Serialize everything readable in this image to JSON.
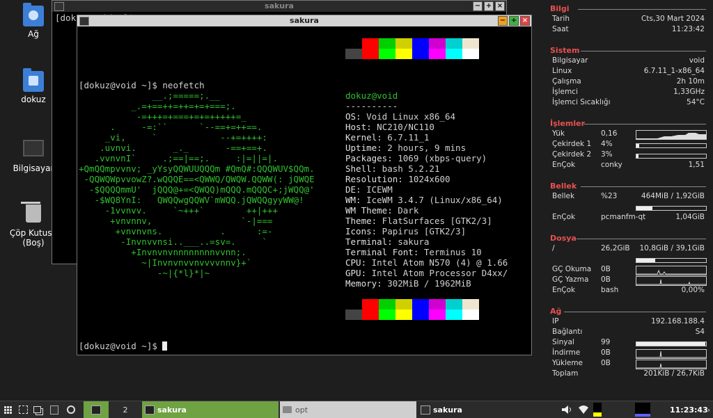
{
  "desktop": {
    "icons": [
      "Ağ",
      "dokuz",
      "Bilgisayar",
      "Çöp Kutusu (Boş)"
    ]
  },
  "windows": {
    "back_title": "sakura",
    "back_prompt": "[dokuz@void ~]$",
    "front_title": "sakura"
  },
  "terminal": {
    "prompt1": "[dokuz@void ~]$ neofetch",
    "prompt2": "[dokuz@void ~]$",
    "user_host": "dokuz@void",
    "separator": "----------",
    "info": [
      {
        "label": "OS",
        "value": "Void Linux x86_64"
      },
      {
        "label": "Host",
        "value": "NC210/NC110"
      },
      {
        "label": "Kernel",
        "value": "6.7.11_1"
      },
      {
        "label": "Uptime",
        "value": "2 hours, 9 mins"
      },
      {
        "label": "Packages",
        "value": "1069 (xbps-query)"
      },
      {
        "label": "Shell",
        "value": "bash 5.2.21"
      },
      {
        "label": "Resolution",
        "value": "1024x600"
      },
      {
        "label": "DE",
        "value": "ICEWM"
      },
      {
        "label": "WM",
        "value": "IceWM 3.4.7 (Linux/x86_64)"
      },
      {
        "label": "WM Theme",
        "value": "Dark"
      },
      {
        "label": "Theme",
        "value": "FlatSurfaces [GTK2/3]"
      },
      {
        "label": "Icons",
        "value": "Papirus [GTK2/3]"
      },
      {
        "label": "Terminal",
        "value": "sakura"
      },
      {
        "label": "Terminal Font",
        "value": "Terminus 10"
      },
      {
        "label": "CPU",
        "value": "Intel Atom N570 (4) @ 1.66"
      },
      {
        "label": "GPU",
        "value": "Intel Atom Processor D4xx/"
      },
      {
        "label": "Memory",
        "value": "302MiB / 1962MiB"
      }
    ],
    "ascii": [
      "              __.;=====;.__",
      "          _.=+==++=++=+=+===;.",
      "           -=+++=+===+=+=+++++=_",
      "      .     -=:``      `--==+=++==.",
      "     _vi,     `            --+=++++:",
      "    .uvnvi.       _._       -==+==+.",
      "   .vvnvnI`     .;==|==;.     :|=||=|.",
      "+QmQQmpvvnv; _yYsyQQWUUQQQm #QmQ#:QQQWUV$QQm.",
      " -QQWQWpvvowZ?.wQQQE==<QWWQ/QWQW.QQWW(: jQWQE",
      "  -$QQQQmmU'  jQQQ@+=<QWQQ)mQQQ.mQQQC+;jWQQ@'",
      "   -$WQ8YnI:   QWQQwgQQWV`mWQQ.jQWQQgyyWW@!",
      "     -1vvnvv.     `~+++`        ++|+++",
      "      +vnvnnv,                 `-|===",
      "       +vnvnvns.           .      :=-",
      "        -Invnvvnsi..___..=sv=.     `",
      "          +Invnvnvnnnnnnnnvvnn;.",
      "            ~|Invnvnvvnvvvvnnv}+`",
      "               -~|{*l}*|~"
    ],
    "palette_top": [
      "#000000",
      "#ff0000",
      "#00d000",
      "#d0d000",
      "#0000ff",
      "#d000d0",
      "#00d0d0",
      "#f0e6d0",
      "#444444",
      "#ff0000",
      "#00ff00",
      "#ffff00",
      "#0000ff",
      "#ff00ff",
      "#00ffff",
      "#ffffff"
    ],
    "palette_bottom": [
      "#000000",
      "#ff0000",
      "#00d000",
      "#d0d000",
      "#0000ff",
      "#d000d0",
      "#00d0d0",
      "#f0e6d0",
      "#444444",
      "#ff0000",
      "#00ff00",
      "#ffff00",
      "#0000ff",
      "#ff00ff",
      "#00ffff",
      "#ffffff"
    ]
  },
  "conky": {
    "bilgi": {
      "title": "Bilgi",
      "rows": [
        {
          "k": "Tarih",
          "v": "Cts,30 Mart 2024"
        },
        {
          "k": "Saat",
          "v": "11:23:42"
        }
      ]
    },
    "sistem": {
      "title": "Sistem",
      "rows": [
        {
          "k": "Bilgisayar",
          "v": "void"
        },
        {
          "k": "Linux",
          "v": "6.7.11_1-x86_64"
        },
        {
          "k": "Çalışma",
          "v": "2h 10m"
        },
        {
          "k": "İşlemci",
          "v": "1,33GHz"
        },
        {
          "k": "İşlemci Sıcaklığı",
          "v": "54°C"
        }
      ]
    },
    "islemler": {
      "title": "İşlemler",
      "yuk": {
        "k": "Yük",
        "m": "0,16"
      },
      "cekirdek1": {
        "k": "Çekirdek 1",
        "m": "4%",
        "fill": 0.04
      },
      "cekirdek2": {
        "k": "Çekirdek 2",
        "m": "3%",
        "fill": 0.03
      },
      "encok": {
        "k": "EnÇok",
        "m": "conky",
        "v": "1,51"
      }
    },
    "bellek": {
      "title": "Bellek",
      "bellek": {
        "k": "Bellek",
        "m": "%23",
        "v": "464MiB / 1,92GiB",
        "fill": 0.23
      },
      "encok": {
        "k": "EnÇok",
        "m": "pcmanfm-qt",
        "v": "1,04GiB"
      }
    },
    "dosya": {
      "title": "Dosya",
      "root": {
        "k": "/",
        "m": "26,2GiB",
        "v": "10,8GiB / 39,1GiB",
        "fill": 0.27
      },
      "okuma": {
        "k": "GÇ Okuma",
        "m": "0B"
      },
      "yazma": {
        "k": "GÇ Yazma",
        "m": "0B"
      },
      "encok": {
        "k": "EnÇok",
        "m": "bash",
        "v": "0,00%"
      }
    },
    "ag": {
      "title": "Ağ",
      "ip": {
        "k": "IP",
        "v": "192.168.188.4"
      },
      "baglanti": {
        "k": "Bağlantı",
        "v": "S4"
      },
      "sinyal": {
        "k": "Sinyal",
        "m": "99",
        "fill": 0.99
      },
      "indirme": {
        "k": "İndirme",
        "m": "0B"
      },
      "yukleme": {
        "k": "Yükleme",
        "m": "0B"
      },
      "toplam": {
        "k": "Toplam",
        "v": "201KiB / 26,7KiB"
      }
    }
  },
  "taskbar": {
    "workspace": "2",
    "tasks": [
      "sakura",
      "opt",
      "sakura"
    ],
    "clock": "11:23:43"
  },
  "colors": {
    "accent_green": "#6fa243",
    "conky_heading": "#e85050",
    "terminal_green": "#30c030"
  }
}
